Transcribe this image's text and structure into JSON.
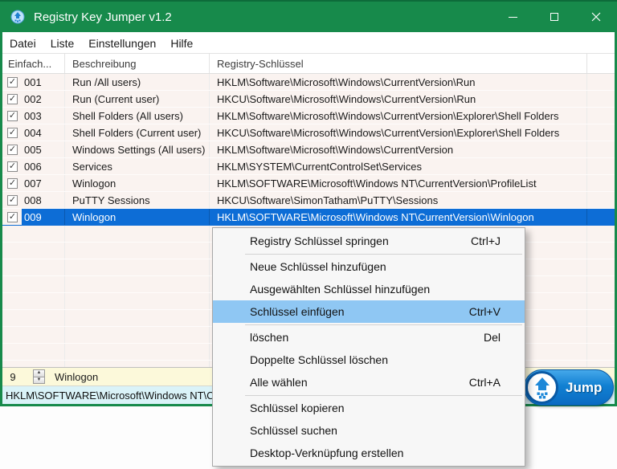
{
  "window": {
    "title": "Registry Key Jumper v1.2",
    "accent_green": "#178a4b",
    "selection_blue": "#0d6dd6"
  },
  "icons": {
    "app": "key-jump-icon",
    "minimize": "–",
    "maximize": "□",
    "close": "✕",
    "checkbox_check": "✓",
    "spinner_up": "▲",
    "spinner_down": "▼",
    "jump": "up-arrow-with-dots"
  },
  "menubar": {
    "items": [
      {
        "label": "Datei"
      },
      {
        "label": "Liste"
      },
      {
        "label": "Einstellungen"
      },
      {
        "label": "Hilfe"
      }
    ]
  },
  "table": {
    "columns": [
      "Einfach...",
      "Beschreibung",
      "Registry-Schlüssel"
    ],
    "rows": [
      {
        "checked": true,
        "num": "001",
        "desc": "Run /All users)",
        "key": "HKLM\\Software\\Microsoft\\Windows\\CurrentVersion\\Run",
        "selected": false
      },
      {
        "checked": true,
        "num": "002",
        "desc": "Run (Current user)",
        "key": "HKCU\\Software\\Microsoft\\Windows\\CurrentVersion\\Run",
        "selected": false
      },
      {
        "checked": true,
        "num": "003",
        "desc": "Shell Folders (All users)",
        "key": "HKLM\\Software\\Microsoft\\Windows\\CurrentVersion\\Explorer\\Shell Folders",
        "selected": false
      },
      {
        "checked": true,
        "num": "004",
        "desc": "Shell Folders (Current user)",
        "key": "HKCU\\Software\\Microsoft\\Windows\\CurrentVersion\\Explorer\\Shell Folders",
        "selected": false
      },
      {
        "checked": true,
        "num": "005",
        "desc": "Windows Settings (All users)",
        "key": "HKLM\\Software\\Microsoft\\Windows\\CurrentVersion",
        "selected": false
      },
      {
        "checked": true,
        "num": "006",
        "desc": "Services",
        "key": "HKLM\\SYSTEM\\CurrentControlSet\\Services",
        "selected": false
      },
      {
        "checked": true,
        "num": "007",
        "desc": "Winlogon",
        "key": "HKLM\\SOFTWARE\\Microsoft\\Windows NT\\CurrentVersion\\ProfileList",
        "selected": false
      },
      {
        "checked": true,
        "num": "008",
        "desc": "PuTTY Sessions",
        "key": "HKCU\\Software\\SimonTatham\\PuTTY\\Sessions",
        "selected": false
      },
      {
        "checked": true,
        "num": "009",
        "desc": "Winlogon",
        "key": "HKLM\\SOFTWARE\\Microsoft\\Windows NT\\CurrentVersion\\Winlogon",
        "selected": true
      }
    ]
  },
  "bottom": {
    "row_number": "9",
    "row_desc": "Winlogon",
    "status_key": "HKLM\\SOFTWARE\\Microsoft\\Windows NT\\Cu",
    "jump_label": "Jump"
  },
  "context_menu": {
    "items": [
      {
        "label": "Registry Schlüssel springen",
        "shortcut": "Ctrl+J"
      },
      {
        "separator": true
      },
      {
        "label": "Neue Schlüssel hinzufügen",
        "shortcut": ""
      },
      {
        "label": "Ausgewählten Schlüssel hinzufügen",
        "shortcut": ""
      },
      {
        "label": "Schlüssel einfügen",
        "shortcut": "Ctrl+V",
        "highlighted": true
      },
      {
        "separator": true
      },
      {
        "label": "löschen",
        "shortcut": "Del"
      },
      {
        "label": "Doppelte Schlüssel löschen",
        "shortcut": ""
      },
      {
        "label": "Alle wählen",
        "shortcut": "Ctrl+A"
      },
      {
        "separator": true
      },
      {
        "label": "Schlüssel kopieren",
        "shortcut": ""
      },
      {
        "label": "Schlüssel suchen",
        "shortcut": ""
      },
      {
        "label": "Desktop-Verknüpfung erstellen",
        "shortcut": ""
      }
    ]
  }
}
